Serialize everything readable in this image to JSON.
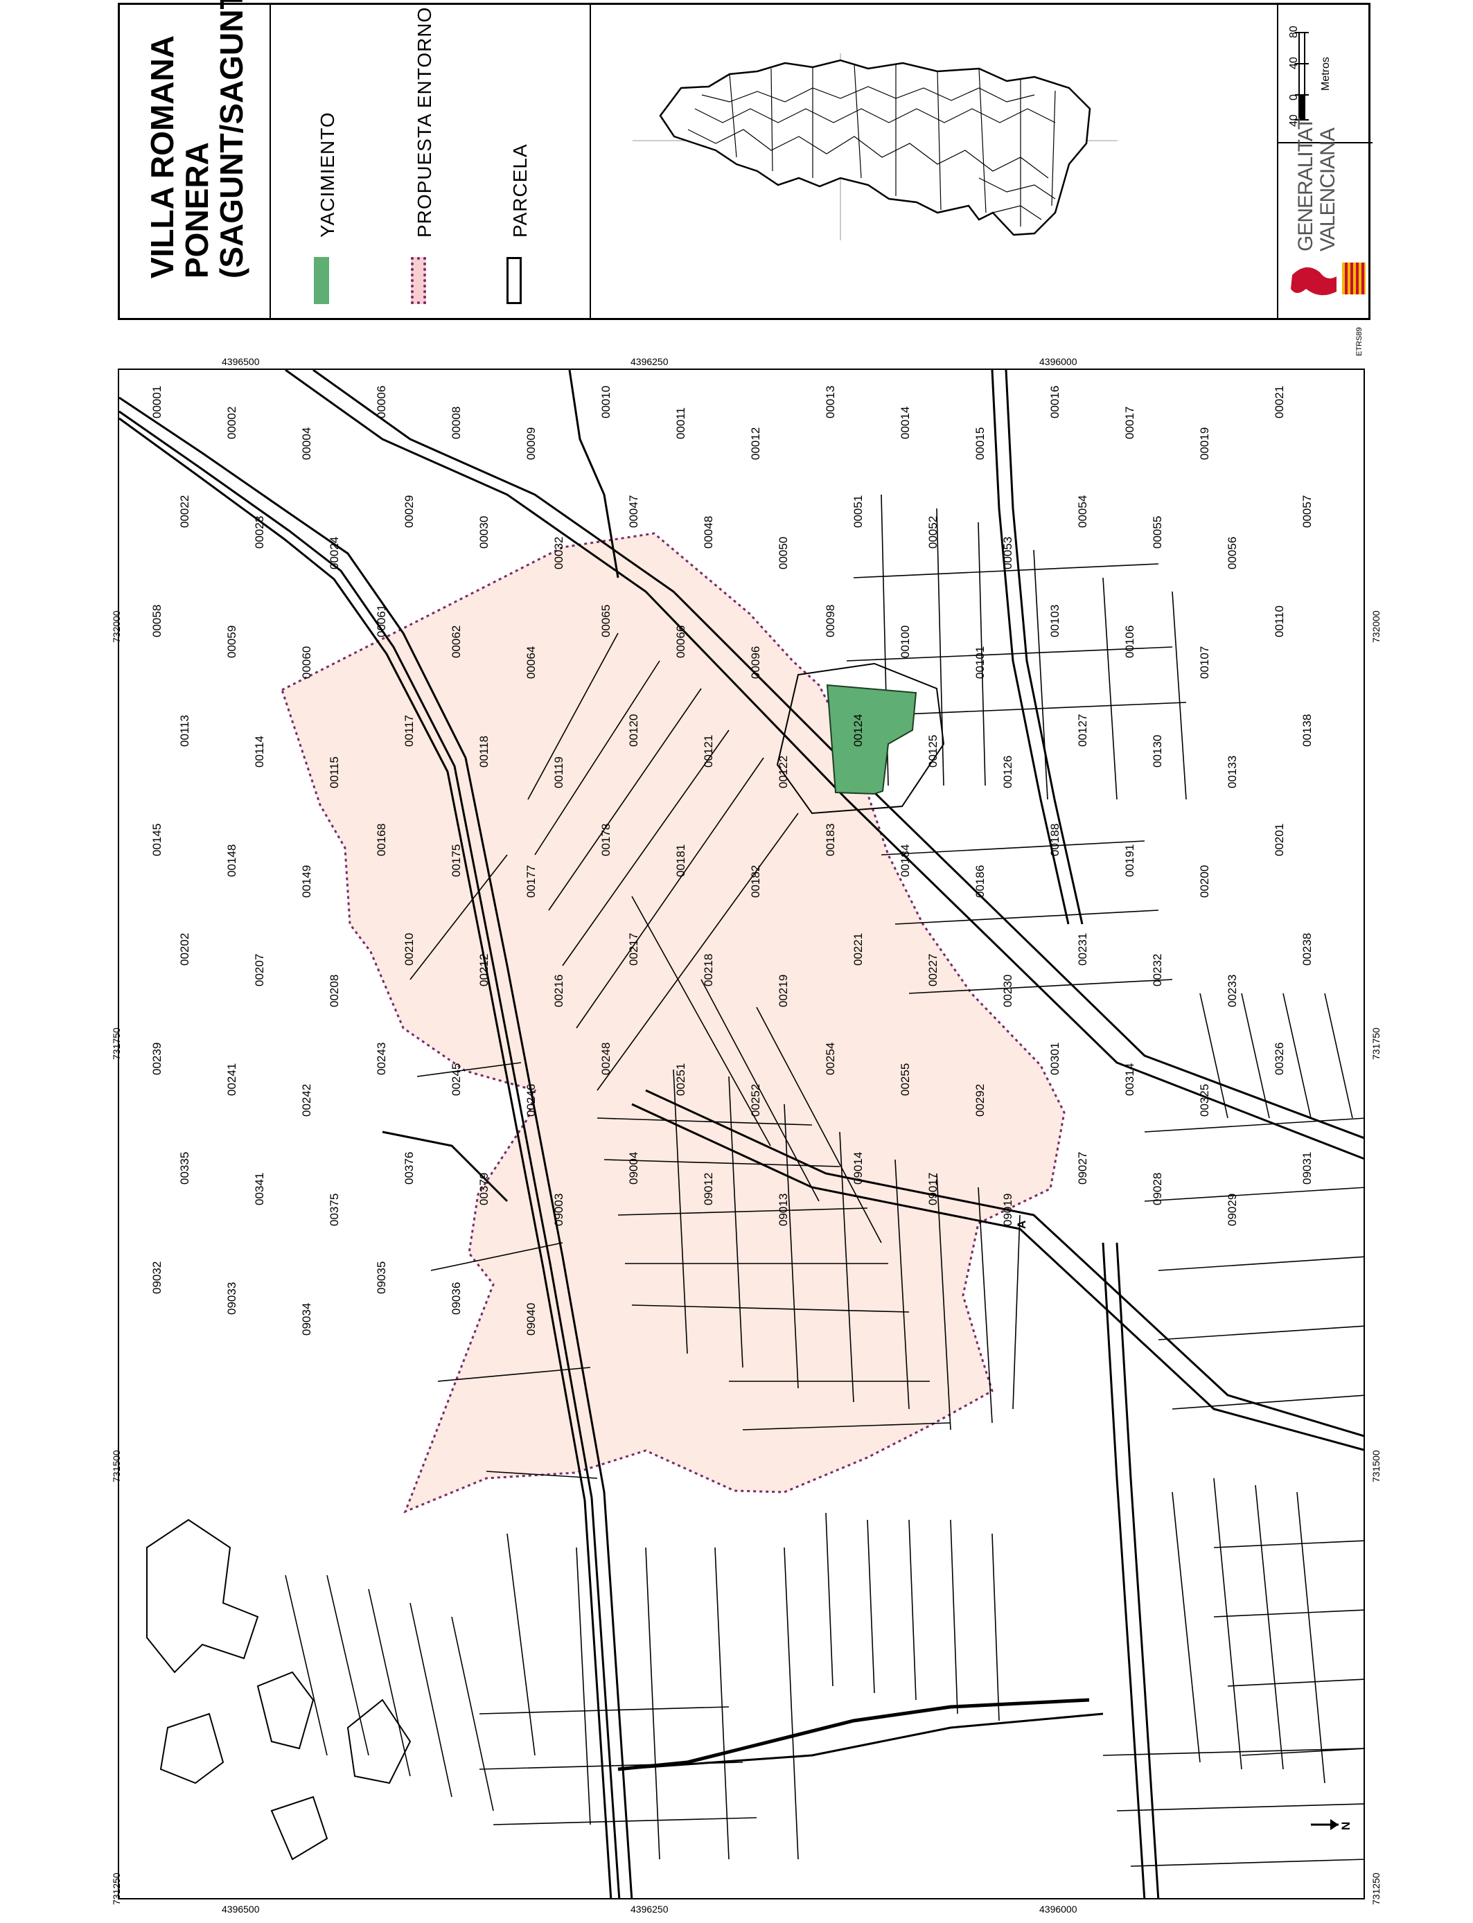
{
  "title": {
    "lines": [
      "VILLA ROMANA",
      "PONERA",
      "(SAGUNT/SAGUNTO)"
    ]
  },
  "legend": {
    "items": [
      {
        "label": "YACIMIENTO",
        "color": "#5fae73",
        "style": "solid"
      },
      {
        "label": "PROPUESTA ENTORNO",
        "color": "#f7cfd0",
        "border": "#7a2a6a",
        "style": "dotted"
      },
      {
        "label": "PARCELA",
        "color": "#ffffff",
        "border": "#000000",
        "style": "solid"
      }
    ]
  },
  "scale": {
    "ticks": [
      "40",
      "0",
      "40",
      "80"
    ],
    "unit": "Metros"
  },
  "logo": {
    "text": [
      "GENERALITAT",
      "VALENCIANA"
    ],
    "colors": {
      "red": "#c8102e",
      "gold": "#f2b800"
    }
  },
  "map": {
    "zone_colors": {
      "entorno_fill": "#fdeae2",
      "entorno_border": "#7a2a6a",
      "yacimiento": "#5fae73"
    },
    "side_labels": {
      "etrs": "ETRS89"
    },
    "coords_y": [
      "731250",
      "731500",
      "731750",
      "732000"
    ],
    "coords_x": [
      "4396500",
      "4396250",
      "4396000"
    ],
    "marker": "A",
    "north": "N",
    "parcels": [
      "00001",
      "00002",
      "00004",
      "00006",
      "00008",
      "00009",
      "00010",
      "00011",
      "00012",
      "00013",
      "00014",
      "00015",
      "00016",
      "00017",
      "00019",
      "00021",
      "00022",
      "00023",
      "00024",
      "00029",
      "00030",
      "00032",
      "00047",
      "00048",
      "00050",
      "00051",
      "00052",
      "00053",
      "00054",
      "00055",
      "00056",
      "00057",
      "00058",
      "00059",
      "00060",
      "00061",
      "00062",
      "00064",
      "00065",
      "00066",
      "00096",
      "00098",
      "00100",
      "00101",
      "00103",
      "00106",
      "00107",
      "00110",
      "00113",
      "00114",
      "00115",
      "00117",
      "00118",
      "00119",
      "00120",
      "00121",
      "00122",
      "00124",
      "00125",
      "00126",
      "00127",
      "00130",
      "00133",
      "00138",
      "00145",
      "00148",
      "00149",
      "00168",
      "00175",
      "00177",
      "00178",
      "00181",
      "00182",
      "00183",
      "00184",
      "00186",
      "00188",
      "00191",
      "00200",
      "00201",
      "00202",
      "00207",
      "00208",
      "00210",
      "00212",
      "00216",
      "00217",
      "00218",
      "00219",
      "00221",
      "00227",
      "00230",
      "00231",
      "00232",
      "00233",
      "00238",
      "00239",
      "00241",
      "00242",
      "00243",
      "00245",
      "00246",
      "00248",
      "00251",
      "00252",
      "00254",
      "00255",
      "00292",
      "00301",
      "00314",
      "00325",
      "00326",
      "00335",
      "00341",
      "00375",
      "00376",
      "00379",
      "09003",
      "09004",
      "09012",
      "09013",
      "09014",
      "09017",
      "09019",
      "09027",
      "09028",
      "09029",
      "09031",
      "09032",
      "09033",
      "09034",
      "09035",
      "09036",
      "09040"
    ]
  }
}
